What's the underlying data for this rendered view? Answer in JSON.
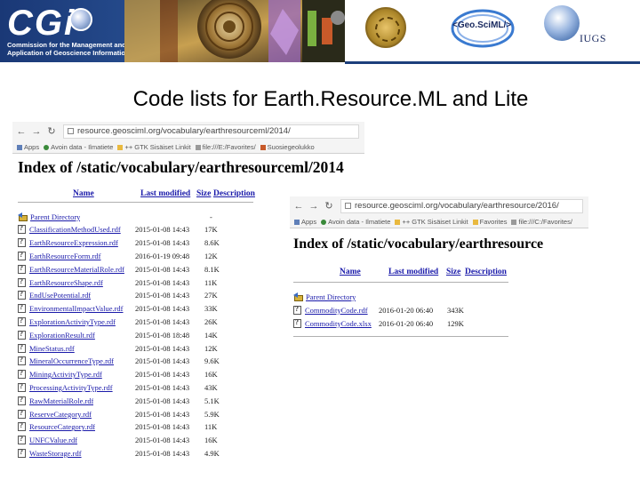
{
  "banner": {
    "cgi_logo": "CGi",
    "cgi_subtitle_line1": "Commission for the Management and",
    "cgi_subtitle_line2": "Application of Geoscience Information",
    "geosciml_logo": "<Geo.SciML/>",
    "iugs_logo": "IUGS",
    "colors": {
      "cgi_blue": "#1d3f7c"
    }
  },
  "title": "Code lists for Earth.Resource.ML and Lite",
  "browser_2014": {
    "url": "resource.geosciml.org/vocabulary/earthresourceml/2014/",
    "bookmarks": [
      {
        "label": "Apps",
        "icon": "apps-icon"
      },
      {
        "label": "Avoin data - Ilmatiete",
        "icon": "avoin-icon"
      },
      {
        "label": "++ GTK Sisäiset Linkit",
        "icon": "folder-icon"
      },
      {
        "label": "file:///E:/Favorites/",
        "icon": "file-icon"
      },
      {
        "label": "Suosiegeolukko",
        "icon": "sub-icon"
      }
    ],
    "heading": "Index of /static/vocabulary/earthresourceml/2014",
    "columns": {
      "name": "Name",
      "modified": "Last modified",
      "size": "Size",
      "description": "Description"
    },
    "parent": {
      "name": "Parent Directory",
      "size": "-"
    },
    "files": [
      {
        "name": "ClassificationMethodUsed.rdf",
        "modified": "2015-01-08 14:43",
        "size": "17K"
      },
      {
        "name": "EarthResourceExpression.rdf",
        "modified": "2015-01-08 14:43",
        "size": "8.6K"
      },
      {
        "name": "EarthResourceForm.rdf",
        "modified": "2016-01-19 09:48",
        "size": "12K"
      },
      {
        "name": "EarthResourceMaterialRole.rdf",
        "modified": "2015-01-08 14:43",
        "size": "8.1K"
      },
      {
        "name": "EarthResourceShape.rdf",
        "modified": "2015-01-08 14:43",
        "size": "11K"
      },
      {
        "name": "EndUsePotential.rdf",
        "modified": "2015-01-08 14:43",
        "size": "27K"
      },
      {
        "name": "EnvironmentalImpactValue.rdf",
        "modified": "2015-01-08 14:43",
        "size": "33K"
      },
      {
        "name": "ExplorationActivityType.rdf",
        "modified": "2015-01-08 14:43",
        "size": "26K"
      },
      {
        "name": "ExplorationResult.rdf",
        "modified": "2015-01-08 18:48",
        "size": "14K"
      },
      {
        "name": "MineStatus.rdf",
        "modified": "2015-01-08 14:43",
        "size": "12K"
      },
      {
        "name": "MineralOccurrenceType.rdf",
        "modified": "2015-01-08 14:43",
        "size": "9.6K"
      },
      {
        "name": "MiningActivityType.rdf",
        "modified": "2015-01-08 14:43",
        "size": "16K"
      },
      {
        "name": "ProcessingActivityType.rdf",
        "modified": "2015-01-08 14:43",
        "size": "43K"
      },
      {
        "name": "RawMaterialRole.rdf",
        "modified": "2015-01-08 14:43",
        "size": "5.1K"
      },
      {
        "name": "ReserveCategory.rdf",
        "modified": "2015-01-08 14:43",
        "size": "5.9K"
      },
      {
        "name": "ResourceCategory.rdf",
        "modified": "2015-01-08 14:43",
        "size": "11K"
      },
      {
        "name": "UNFCValue.rdf",
        "modified": "2015-01-08 14:43",
        "size": "16K"
      },
      {
        "name": "WasteStorage.rdf",
        "modified": "2015-01-08 14:43",
        "size": "4.9K"
      }
    ]
  },
  "browser_2016": {
    "url": "resource.geosciml.org/vocabulary/earthresource/2016/",
    "bookmarks": [
      {
        "label": "Apps",
        "icon": "apps-icon"
      },
      {
        "label": "Avoin data - Ilmatiete",
        "icon": "avoin-icon"
      },
      {
        "label": "++ GTK Sisäiset Linkit",
        "icon": "folder-icon"
      },
      {
        "label": "Favorites",
        "icon": "folder-icon"
      },
      {
        "label": "file:///C:/Favorites/",
        "icon": "file-icon"
      }
    ],
    "heading": "Index of /static/vocabulary/earthresource",
    "columns": {
      "name": "Name",
      "modified": "Last modified",
      "size": "Size",
      "description": "Description"
    },
    "parent": {
      "name": "Parent Directory"
    },
    "files": [
      {
        "name": "CommodityCode.rdf",
        "modified": "2016-01-20 06:40",
        "size": "343K"
      },
      {
        "name": "CommodityCode.xlsx",
        "modified": "2016-01-20 06:40",
        "size": "129K"
      }
    ]
  }
}
